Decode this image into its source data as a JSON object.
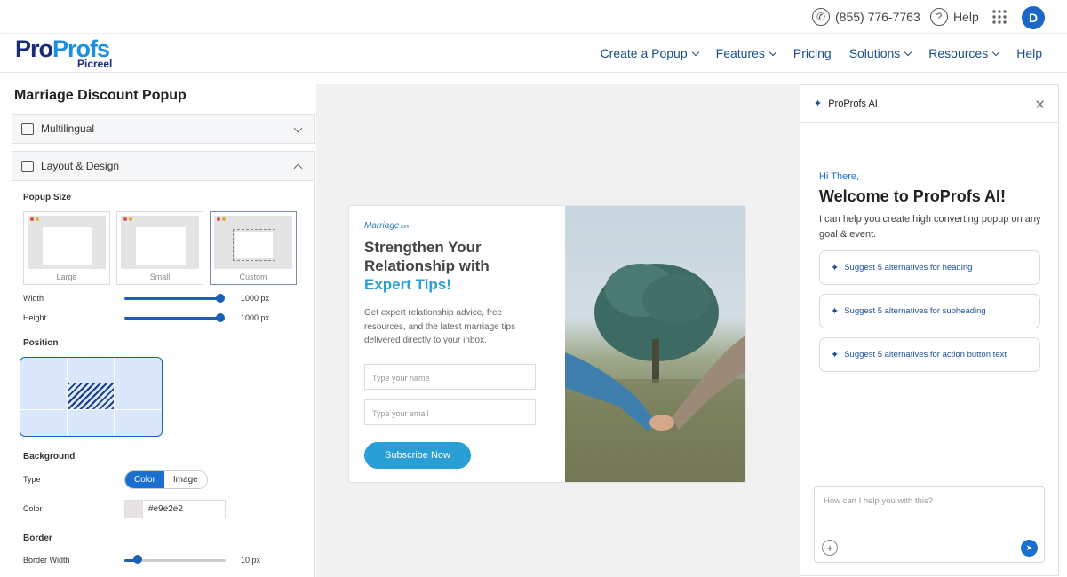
{
  "topbar": {
    "phone": "(855) 776-7763",
    "help": "Help",
    "avatar_letter": "D"
  },
  "logo": {
    "part1": "Pro",
    "part2": "Profs",
    "sub": "Picreel"
  },
  "nav": [
    {
      "label": "Create a Popup"
    },
    {
      "label": "Features"
    },
    {
      "label": "Pricing"
    },
    {
      "label": "Solutions"
    },
    {
      "label": "Resources"
    },
    {
      "label": "Help"
    }
  ],
  "left": {
    "title": "Marriage Discount Popup",
    "multilingual": "Multilingual",
    "layout_design": "Layout & Design",
    "popup_size": "Popup Size",
    "sizes": [
      "Large",
      "Small",
      "Custom"
    ],
    "width_label": "Width",
    "width_value": "1000 px",
    "height_label": "Height",
    "height_value": "1000 px",
    "position": "Position",
    "background": "Background",
    "type_label": "Type",
    "type_options": [
      "Color",
      "Image"
    ],
    "color_label": "Color",
    "color_value": "#e9e2e2",
    "border": "Border",
    "border_width_label": "Border Width",
    "border_width_value": "10 px"
  },
  "popup": {
    "brand": "Marriage",
    "brand_suffix": ".com",
    "heading_line1": "Strengthen Your",
    "heading_line2": "Relationship with",
    "heading_accent": "Expert Tips!",
    "description": "Get expert relationship advice, free resources, and the latest marriage tips delivered directly to your inbox.",
    "name_placeholder": "Type your name",
    "email_placeholder": "Type your email",
    "cta": "Subscribe Now"
  },
  "ai": {
    "title": "ProProfs AI",
    "hi": "Hi There,",
    "welcome": "Welcome to ProProfs AI!",
    "intro": "I can help you create high converting popup on any goal & event.",
    "suggestions": [
      "Suggest 5 alternatives for heading",
      "Suggest 5 alternatives for subheading",
      "Suggest 5 alternatives for action button text"
    ],
    "input_placeholder": "How can I help you with this?"
  },
  "colors": {
    "accent": "#1a6fd1",
    "popup_accent": "#2a9fd6",
    "brand_dark": "#1a2b7c"
  }
}
